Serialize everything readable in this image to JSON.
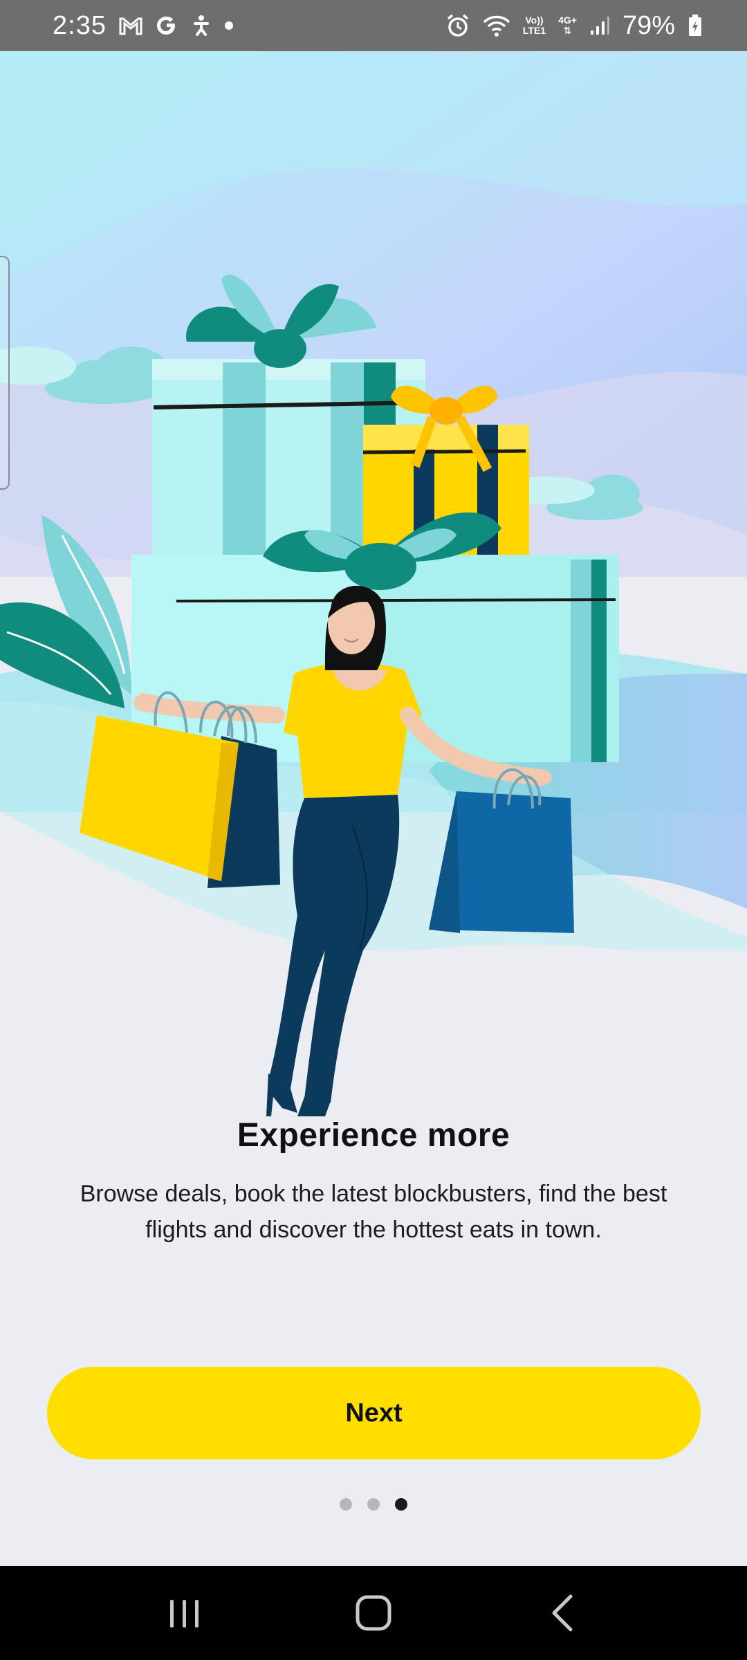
{
  "status_bar": {
    "time": "2:35",
    "battery": "79%",
    "lte_top": "Vo))",
    "lte_bottom": "LTE1",
    "network": "4G+",
    "icons": [
      "gmail-icon",
      "google-icon",
      "accessibility-icon",
      "notification-dot-icon",
      "alarm-icon",
      "wifi-icon",
      "volte-icon",
      "4g-icon",
      "signal-icon",
      "battery-charging-icon"
    ]
  },
  "hero": {
    "illustration": "woman-with-shopping-bags-and-gift-boxes",
    "colors": {
      "sky": "#b9e8f7",
      "teal": "#7fd6d6",
      "dark_teal": "#0f8c7e",
      "yellow": "#ffd600",
      "navy": "#0c3a5c",
      "blue_bag": "#0f67a6"
    }
  },
  "onboarding": {
    "title": "Experience more",
    "body": "Browse deals, book the latest blockbusters, find the best flights and discover the hottest eats in town.",
    "next_label": "Next",
    "pages_total": 3,
    "current_page": 3
  },
  "colors": {
    "accent": "#ffde00",
    "background": "#ecedf2"
  },
  "nav_bar": {
    "icons": [
      "recent-apps-icon",
      "home-icon",
      "back-icon"
    ]
  }
}
